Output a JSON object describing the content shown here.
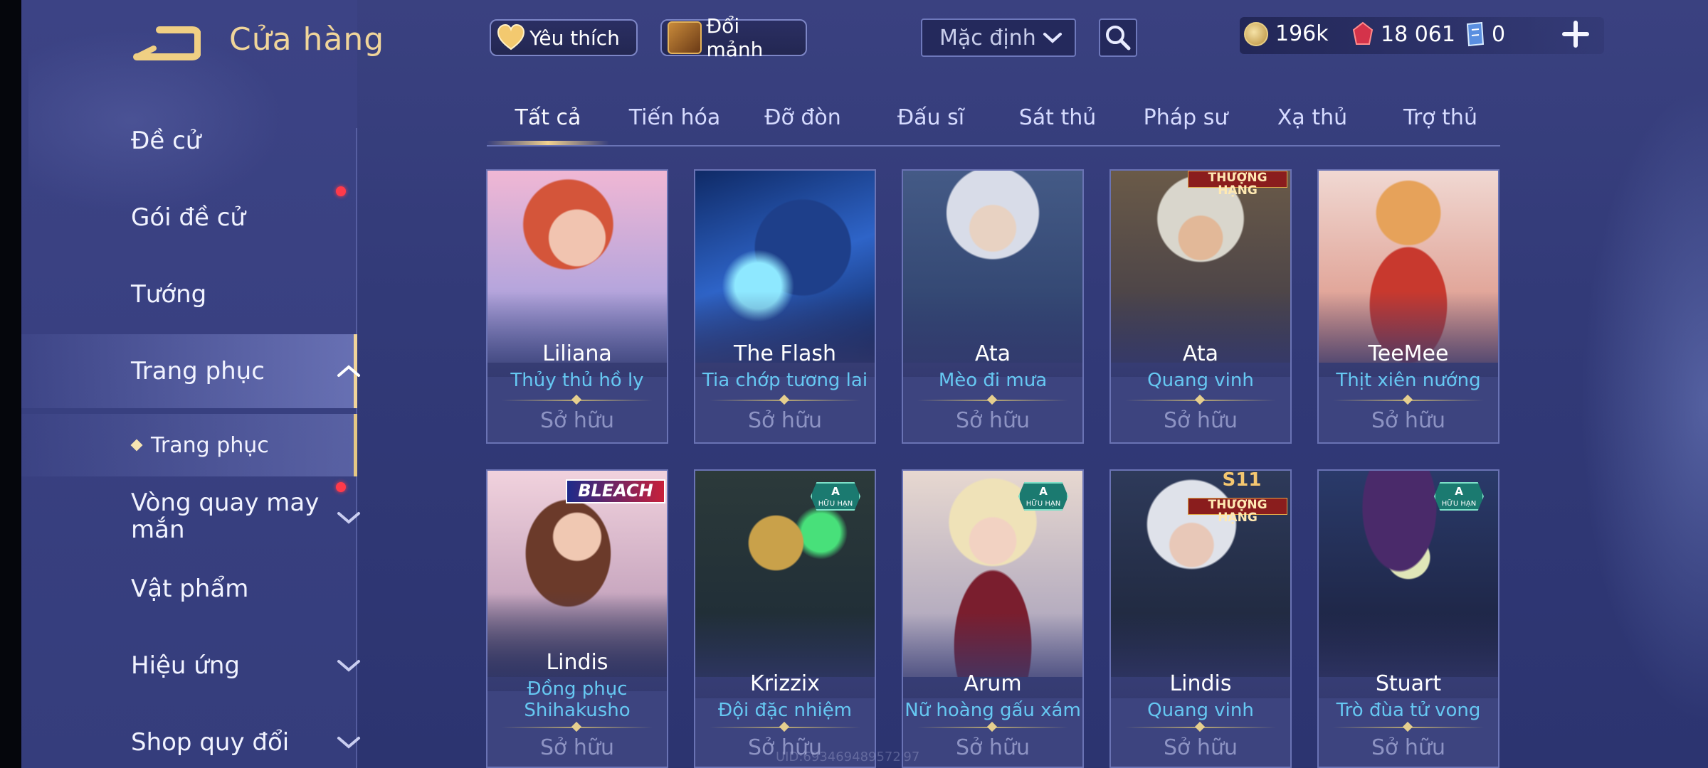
{
  "header": {
    "title": "Cửa hàng",
    "favorite_label": "Yêu thích",
    "shard_label": "Đổi mảnh",
    "sort": {
      "selected": "Mặc định"
    }
  },
  "currency": {
    "gold": "196k",
    "ruby": "18 061",
    "ticket": "0"
  },
  "sidebar": {
    "items": [
      {
        "label": "Đề cử"
      },
      {
        "label": "Gói đề cử"
      },
      {
        "label": "Tướng"
      },
      {
        "label": "Trang phục"
      },
      {
        "label": "Trang phục"
      },
      {
        "label_line1": "Vòng quay may",
        "label_line2": "mắn"
      },
      {
        "label": "Vật phẩm"
      },
      {
        "label": "Hiệu ứng"
      },
      {
        "label": "Shop quy đổi"
      }
    ]
  },
  "tabs": [
    "Tất cả",
    "Tiến hóa",
    "Đỡ đòn",
    "Đấu sĩ",
    "Sát thủ",
    "Pháp sư",
    "Xạ thủ",
    "Trợ thủ"
  ],
  "cards": [
    {
      "hero": "Liliana",
      "skin": "Thủy thủ hồ ly",
      "status": "Sở hữu"
    },
    {
      "hero": "The Flash",
      "skin": "Tia chớp tương lai",
      "status": "Sở hữu"
    },
    {
      "hero": "Ata",
      "skin": "Mèo đi mưa",
      "status": "Sở hữu"
    },
    {
      "hero": "Ata",
      "skin": "Quang vinh",
      "status": "Sở hữu",
      "badge": "THƯỢNG HẠNG"
    },
    {
      "hero": "TeeMee",
      "skin": "Thịt xiên nướng",
      "status": "Sở hữu"
    },
    {
      "hero": "Lindis",
      "skin_line1": "Đồng phục",
      "skin_line2": "Shihakusho",
      "status": "Sở hữu",
      "badge": "BLEACH"
    },
    {
      "hero": "Krizzix",
      "skin": "Đội đặc nhiệm",
      "status": "Sở hữu",
      "badge_grade": "A",
      "badge_sub": "HỮU HẠN"
    },
    {
      "hero": "Arum",
      "skin": "Nữ hoàng gấu xám",
      "status": "Sở hữu",
      "badge_grade": "A",
      "badge_sub": "HỮU HẠN"
    },
    {
      "hero": "Lindis",
      "skin": "Quang vinh",
      "status": "Sở hữu",
      "badge_top": "S11",
      "badge": "THƯỢNG HẠNG"
    },
    {
      "hero": "Stuart",
      "skin": "Trò đùa tử vong",
      "status": "Sở hữu",
      "badge_grade": "A",
      "badge_sub": "HỮU HẠN"
    }
  ],
  "watermark": "UID:693469489572 97",
  "colors": {
    "accent_gold": "#f0d59a",
    "skin_name": "#66c8f2",
    "notification": "#ff3a4a"
  }
}
